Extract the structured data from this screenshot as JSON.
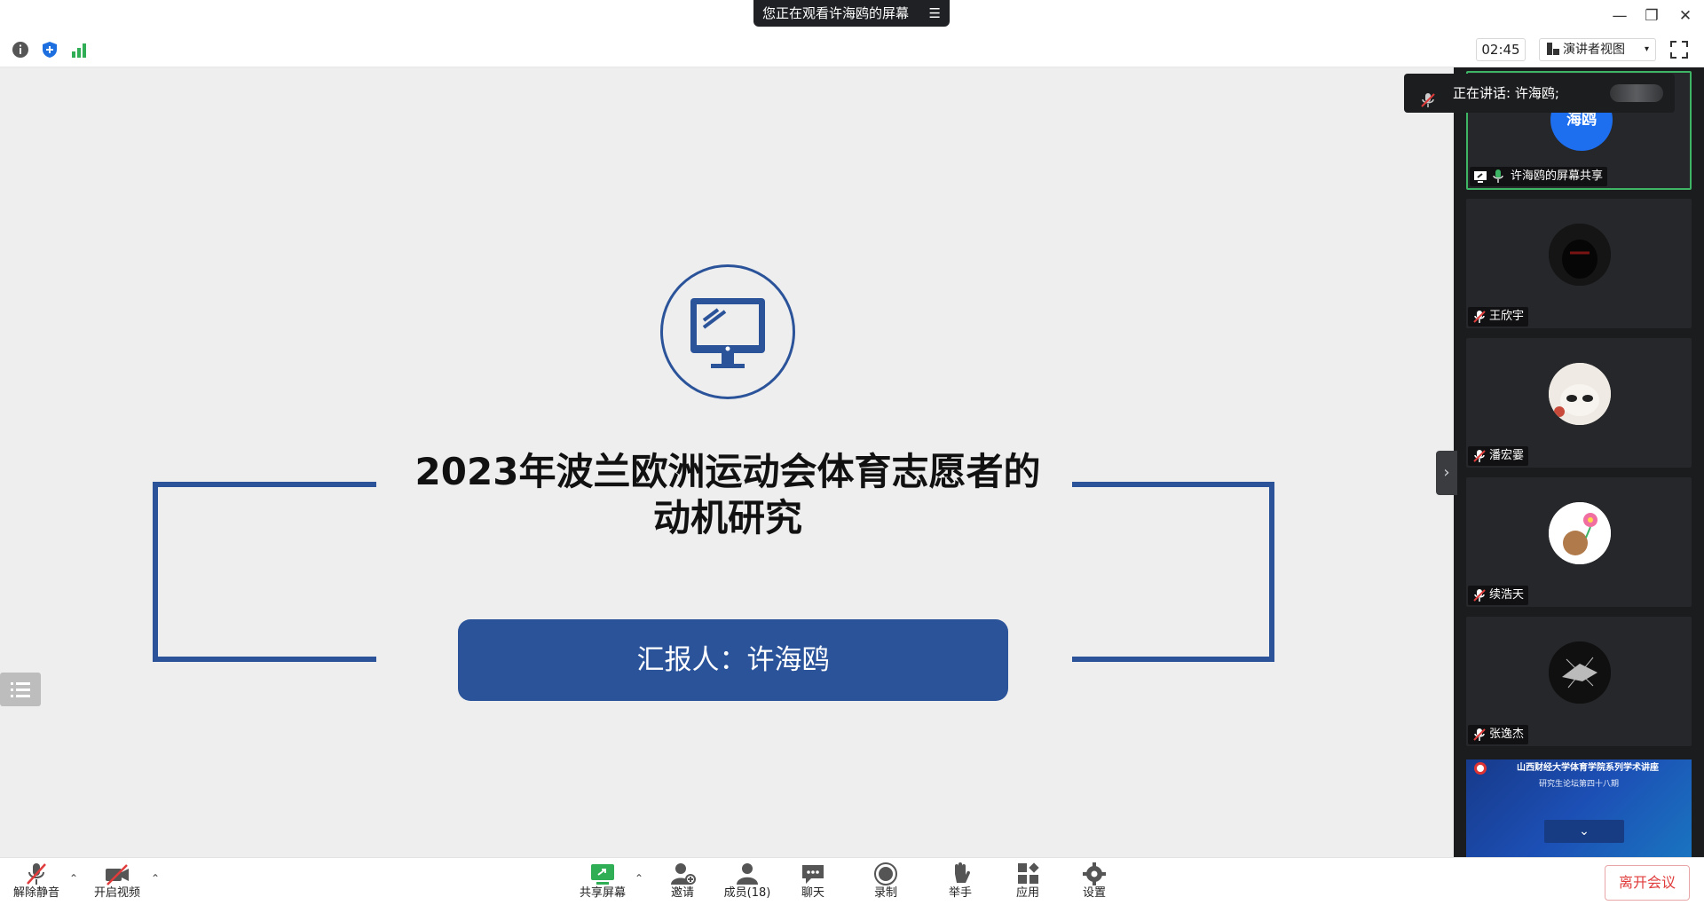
{
  "window": {
    "viewing_text": "您正在观看许海鸥的屏幕",
    "controls": {
      "minimize": "—",
      "restore": "❐",
      "close": "✕"
    }
  },
  "toolbar": {
    "timer": "02:45",
    "view_label": "演讲者视图",
    "view_caret": "▾"
  },
  "slide": {
    "title_line1": "2023年波兰欧洲运动会体育志愿者的",
    "title_line2": "动机研究",
    "reporter": "汇报人：许海鸥"
  },
  "speaking": {
    "label": "正在讲话: 许海鸥;"
  },
  "panel": {
    "first_tile": {
      "avatar_text": "海鸥",
      "name": "许海鸥的屏幕共享"
    },
    "participants": [
      {
        "name": "王欣宇",
        "avatar": "dark-figure"
      },
      {
        "name": "潘宏霎",
        "avatar": "plush-toy"
      },
      {
        "name": "续浩天",
        "avatar": "bear-flower"
      },
      {
        "name": "张逸杰",
        "avatar": "sparkle-dark"
      }
    ],
    "thumb": {
      "line1": "山西财经大学体育学院系列学术讲座",
      "line2": "研究生论坛第四十八期",
      "expand": "⌄"
    }
  },
  "bottom": {
    "unmute": "解除静音",
    "start_video": "开启视频",
    "share_screen": "共享屏幕",
    "invite": "邀请",
    "members": "成员(18)",
    "chat": "聊天",
    "record": "录制",
    "raise_hand": "举手",
    "apps": "应用",
    "settings": "设置",
    "leave": "离开会议"
  },
  "colors": {
    "brand_blue": "#2b539a",
    "active_green": "#3eb564",
    "leave_red": "#e03c3c"
  }
}
